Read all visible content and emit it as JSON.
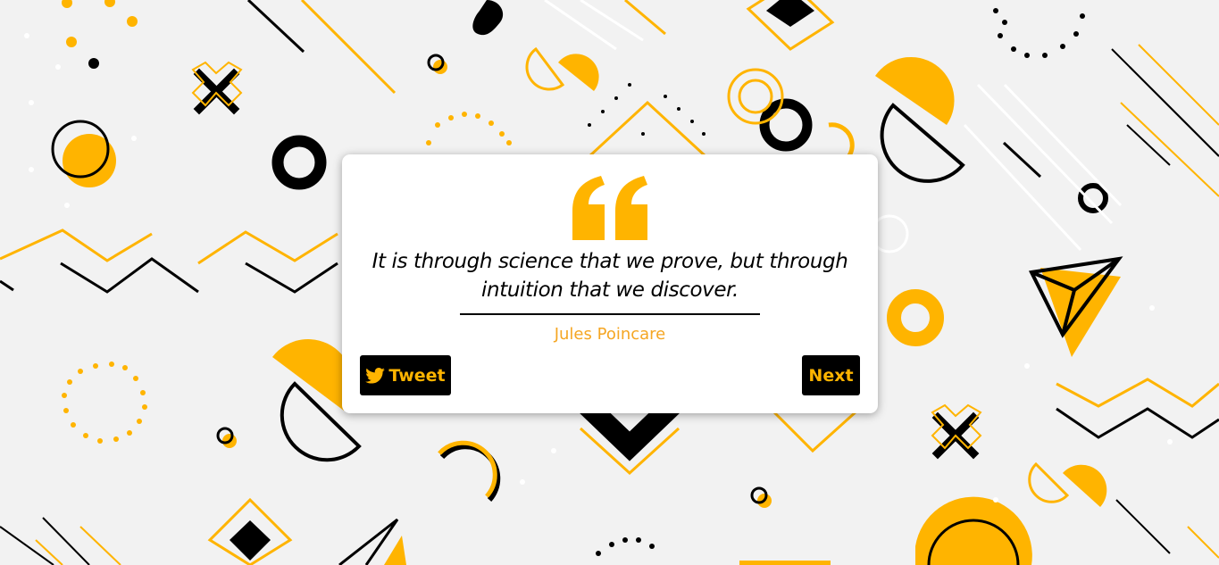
{
  "quote": {
    "text": "It is through science that we prove, but through intuition that we discover.",
    "author": "Jules Poincare"
  },
  "buttons": {
    "tweet_label": "Tweet",
    "next_label": "Next"
  },
  "icons": {
    "quote": "quote-icon",
    "tweet": "twitter-icon"
  },
  "colors": {
    "accent": "#ffb400",
    "author": "#f5a623",
    "background": "#f2f2f2",
    "button_bg": "#000000"
  }
}
